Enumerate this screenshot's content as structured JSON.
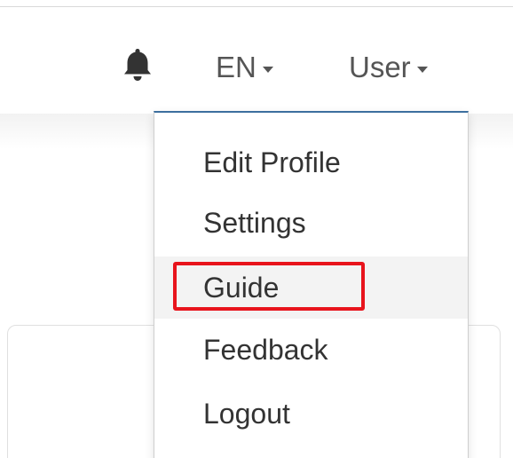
{
  "navbar": {
    "notifications_icon": "bell-icon",
    "language": {
      "label": "EN",
      "icon": "caret-down-icon"
    },
    "user": {
      "label": "User",
      "icon": "caret-down-icon"
    }
  },
  "user_menu": {
    "items": [
      {
        "label": "Edit Profile"
      },
      {
        "label": "Settings"
      },
      {
        "label": "Guide",
        "highlighted": true
      },
      {
        "label": "Feedback"
      },
      {
        "label": "Logout"
      }
    ]
  },
  "colors": {
    "menu_top_border": "#3d6f9e",
    "annotation_red": "#e8141c",
    "hover_bg": "#f3f3f3",
    "nav_text": "#555555",
    "menu_text": "#333333"
  }
}
